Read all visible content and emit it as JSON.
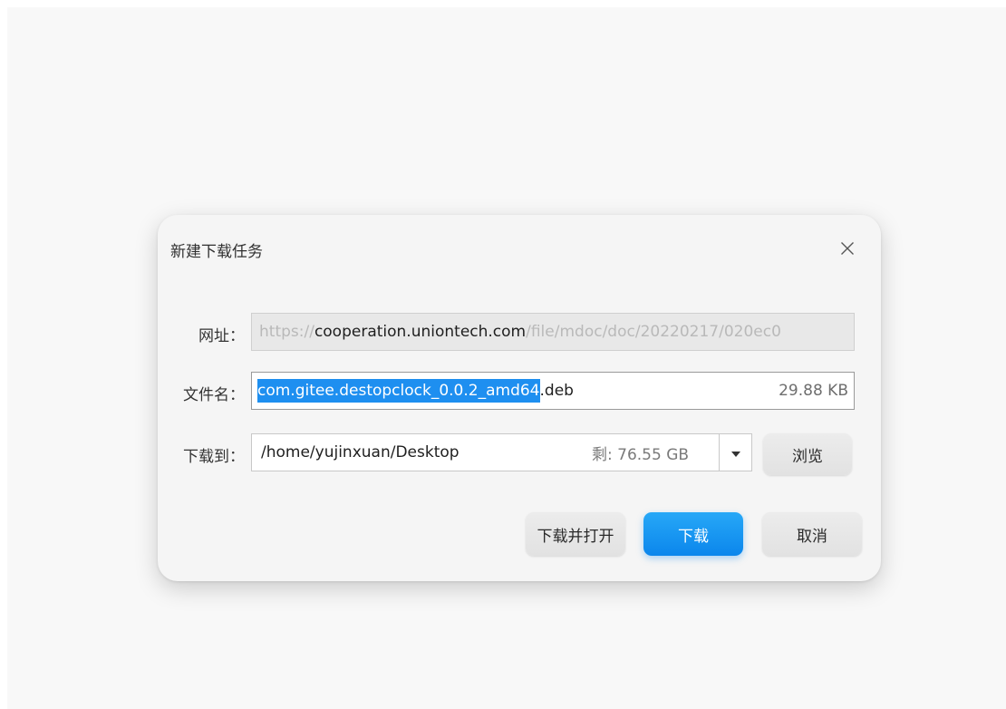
{
  "dialog": {
    "title": "新建下载任务",
    "close_icon": "close-icon"
  },
  "url_row": {
    "label": "网址：",
    "scheme": "https://",
    "host": "cooperation.uniontech.com",
    "path": "/file/mdoc/doc/20220217/020ec0"
  },
  "name_row": {
    "label": "文件名：",
    "name_selected": "com.gitee.destopclock_0.0.2_amd64",
    "extension": ".deb",
    "size": "29.88 KB"
  },
  "dir_row": {
    "label": "下载到：",
    "path": "/home/yujinxuan/Desktop",
    "free_space": "剩: 76.55 GB",
    "dropdown_icon": "caret-down-icon",
    "browse_label": "浏览"
  },
  "actions": {
    "download_and_open": "下载并打开",
    "download": "下载",
    "cancel": "取消"
  },
  "colors": {
    "accent": "#0b86ec",
    "selection": "#1e8ff0"
  }
}
